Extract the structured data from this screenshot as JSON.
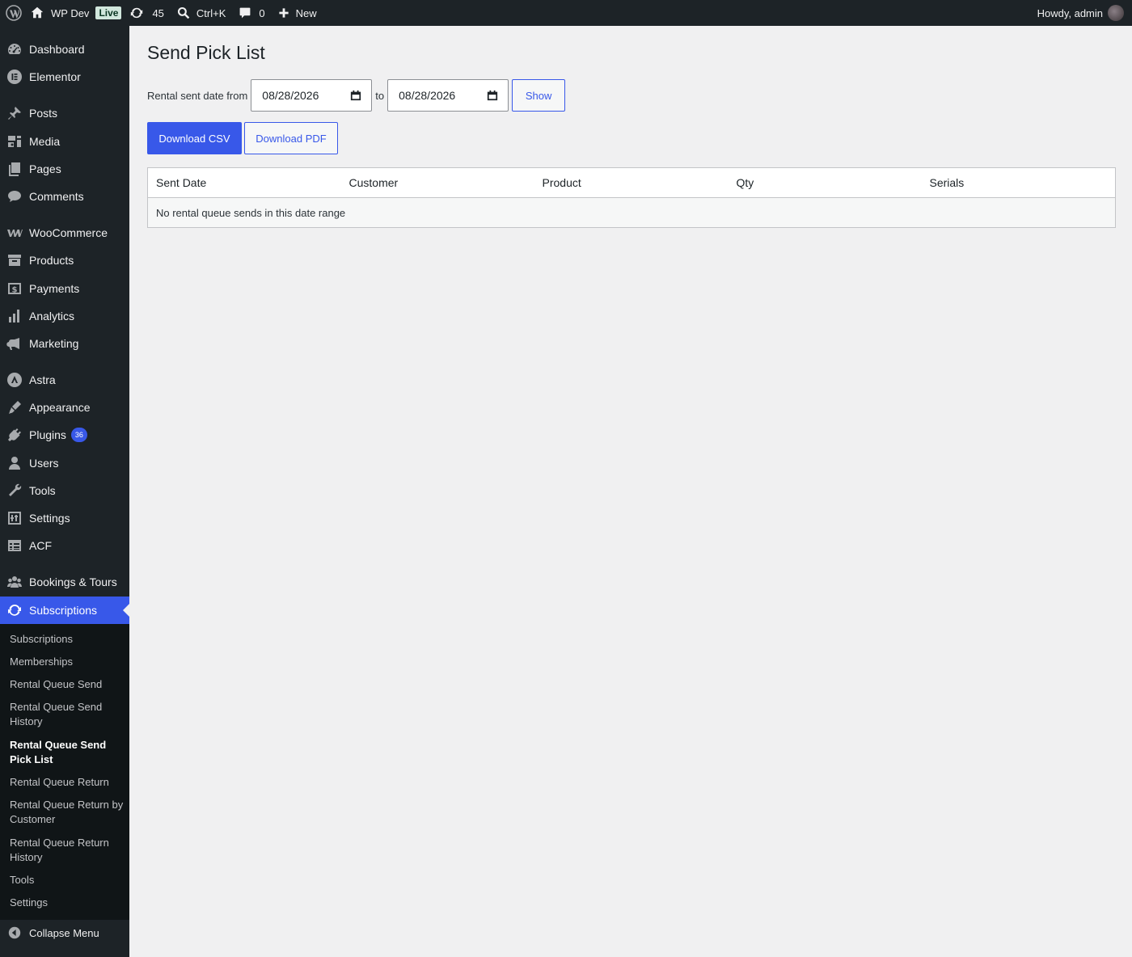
{
  "adminbar": {
    "site_name": "WP Dev",
    "live_label": "Live",
    "updates_count": "45",
    "search_shortcut": "Ctrl+K",
    "comments_count": "0",
    "new_label": "New",
    "greeting": "Howdy, admin"
  },
  "sidebar": {
    "items": [
      {
        "label": "Dashboard",
        "icon": "dashboard-icon"
      },
      {
        "label": "Elementor",
        "icon": "elementor-icon"
      },
      {
        "label": "Posts",
        "icon": "pin-icon"
      },
      {
        "label": "Media",
        "icon": "media-icon"
      },
      {
        "label": "Pages",
        "icon": "pages-icon"
      },
      {
        "label": "Comments",
        "icon": "comment-icon"
      },
      {
        "label": "WooCommerce",
        "icon": "woocommerce-icon"
      },
      {
        "label": "Products",
        "icon": "archive-icon"
      },
      {
        "label": "Payments",
        "icon": "dollar-icon"
      },
      {
        "label": "Analytics",
        "icon": "bar-chart-icon"
      },
      {
        "label": "Marketing",
        "icon": "megaphone-icon"
      },
      {
        "label": "Astra",
        "icon": "astra-icon"
      },
      {
        "label": "Appearance",
        "icon": "brush-icon"
      },
      {
        "label": "Plugins",
        "icon": "plug-icon",
        "badge": "36"
      },
      {
        "label": "Users",
        "icon": "user-icon"
      },
      {
        "label": "Tools",
        "icon": "wrench-icon"
      },
      {
        "label": "Settings",
        "icon": "sliders-icon"
      },
      {
        "label": "ACF",
        "icon": "table-icon"
      },
      {
        "label": "Bookings & Tours",
        "icon": "groups-icon"
      },
      {
        "label": "Subscriptions",
        "icon": "sync-icon",
        "current": true
      }
    ],
    "submenu": [
      {
        "label": "Subscriptions"
      },
      {
        "label": "Memberships"
      },
      {
        "label": "Rental Queue Send"
      },
      {
        "label": "Rental Queue Send History"
      },
      {
        "label": "Rental Queue Send Pick List",
        "current": true
      },
      {
        "label": "Rental Queue Return"
      },
      {
        "label": "Rental Queue Return by Customer"
      },
      {
        "label": "Rental Queue Return History"
      },
      {
        "label": "Tools"
      },
      {
        "label": "Settings"
      }
    ],
    "collapse_label": "Collapse Menu"
  },
  "page": {
    "title": "Send Pick List",
    "filter": {
      "from_label": "Rental sent date from",
      "from_value": "08/28/2026",
      "to_label": "to",
      "to_value": "08/28/2026",
      "show_label": "Show"
    },
    "download_csv_label": "Download CSV",
    "download_pdf_label": "Download PDF",
    "table": {
      "headers": [
        "Sent Date",
        "Customer",
        "Product",
        "Qty",
        "Serials"
      ],
      "empty_message": "No rental queue sends in this date range"
    }
  },
  "colors": {
    "accent": "#3858e9",
    "admin_bar": "#1d2327",
    "submenu_bg": "#101517",
    "background": "#f0f0f1",
    "live_badge_bg": "#d1e7dd"
  }
}
